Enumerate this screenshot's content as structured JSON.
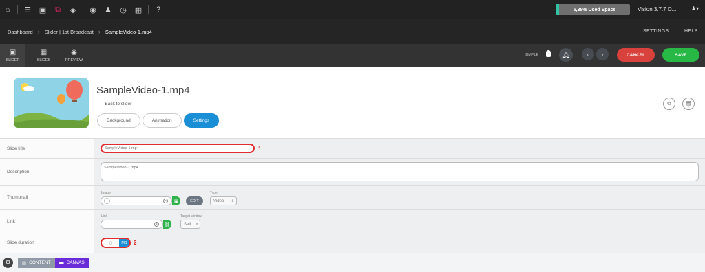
{
  "topbar": {
    "icons": [
      "home-icon",
      "list-icon",
      "image-icon",
      "layers-icon",
      "cube-icon",
      "eye-icon",
      "users-icon",
      "clock-icon",
      "grid-icon",
      "help-icon"
    ],
    "storage_label": "5,38% Used Space",
    "storage_percent": 5.38,
    "version": "Vision 3.7.7 D..."
  },
  "breadcrumb": {
    "items": [
      "Dashboard",
      "Slider | 1st Broadcast",
      "SampleVideo-1.mp4"
    ],
    "right_links": [
      "SETTINGS",
      "HELP"
    ]
  },
  "toolbar": {
    "buttons": [
      "SLIDER",
      "SLIDES",
      "PREVIEW"
    ],
    "simple_label": "SIMPLE",
    "cancel_label": "CANCEL",
    "save_label": "SAVE"
  },
  "slide": {
    "title": "SampleVideo-1.mp4",
    "back_link": "Back to slider",
    "tabs": [
      "Background",
      "Animation",
      "Settings"
    ],
    "active_tab": "Settings"
  },
  "settings": {
    "labels": [
      "Slide title",
      "Description",
      "Thumbnail",
      "Link",
      "Slide duration"
    ],
    "slide_title_value": "SampleVideo-1.mp4",
    "description_value": "SampleVideo-1.mp4",
    "image_label": "Image",
    "edit_label": "EDIT",
    "type_label": "Type",
    "type_value": "Video",
    "link_label": "Link",
    "target_label": "Target window",
    "target_value": "Self",
    "duration_unit": "MS",
    "marker_1": "1",
    "marker_2": "2"
  },
  "bottombar": {
    "content_label": "CONTENT",
    "canvas_label": "CANVAS"
  },
  "colors": {
    "cancel": "#d9413c",
    "save": "#27b845",
    "active_tab": "#1a8fd6",
    "canvas": "#6a2bd8",
    "highlight": "#e02c2c"
  }
}
